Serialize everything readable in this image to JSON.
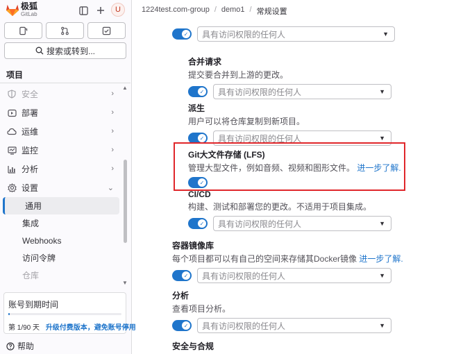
{
  "app": {
    "logo_cn": "极狐",
    "logo_en": "GitLab",
    "avatar_letter": "U"
  },
  "sidebar": {
    "search_label": "搜索或转到...",
    "section_title": "项目",
    "nav": [
      {
        "label": "安全",
        "icon": "shield-icon",
        "faded": true
      },
      {
        "label": "部署",
        "icon": "deploy-icon"
      },
      {
        "label": "运维",
        "icon": "cloud-icon"
      },
      {
        "label": "监控",
        "icon": "monitor-icon"
      },
      {
        "label": "分析",
        "icon": "chart-icon"
      },
      {
        "label": "设置",
        "icon": "gear-icon"
      }
    ],
    "settings_sub": [
      "通用",
      "集成",
      "Webhooks",
      "访问令牌",
      "仓库"
    ],
    "trial": {
      "title": "账号到期时间",
      "progress": 0.012,
      "days": "第 1/90 天",
      "link": "升级付费版本，避免账号停用"
    },
    "help": "帮助"
  },
  "breadcrumb": [
    "1224test.com-group",
    "demo1",
    "常规设置"
  ],
  "placeholder": "具有访问权限的任何人",
  "permissions": {
    "merge": {
      "title": "合并请求",
      "desc": "提交要合并到上游的更改。"
    },
    "fork": {
      "title": "派生",
      "desc": "用户可以将仓库复制到新项目。"
    },
    "lfs": {
      "title": "Git大文件存储 (LFS)",
      "desc": "管理大型文件，例如音频、视频和图形文件。",
      "link": "进一步了解."
    },
    "cicd": {
      "title": "CI/CD",
      "desc": "构建、测试和部署您的更改。不适用于项目集成。"
    },
    "registry": {
      "title": "容器镜像库",
      "desc": "每个项目都可以有自己的空间来存储其Docker镜像",
      "link": "进一步了解."
    },
    "analytics": {
      "title": "分析",
      "desc": "查看项目分析。"
    },
    "security": {
      "title": "安全与合规"
    }
  },
  "colors": {
    "accent": "#1f75cb",
    "highlight": "#e0262a"
  }
}
